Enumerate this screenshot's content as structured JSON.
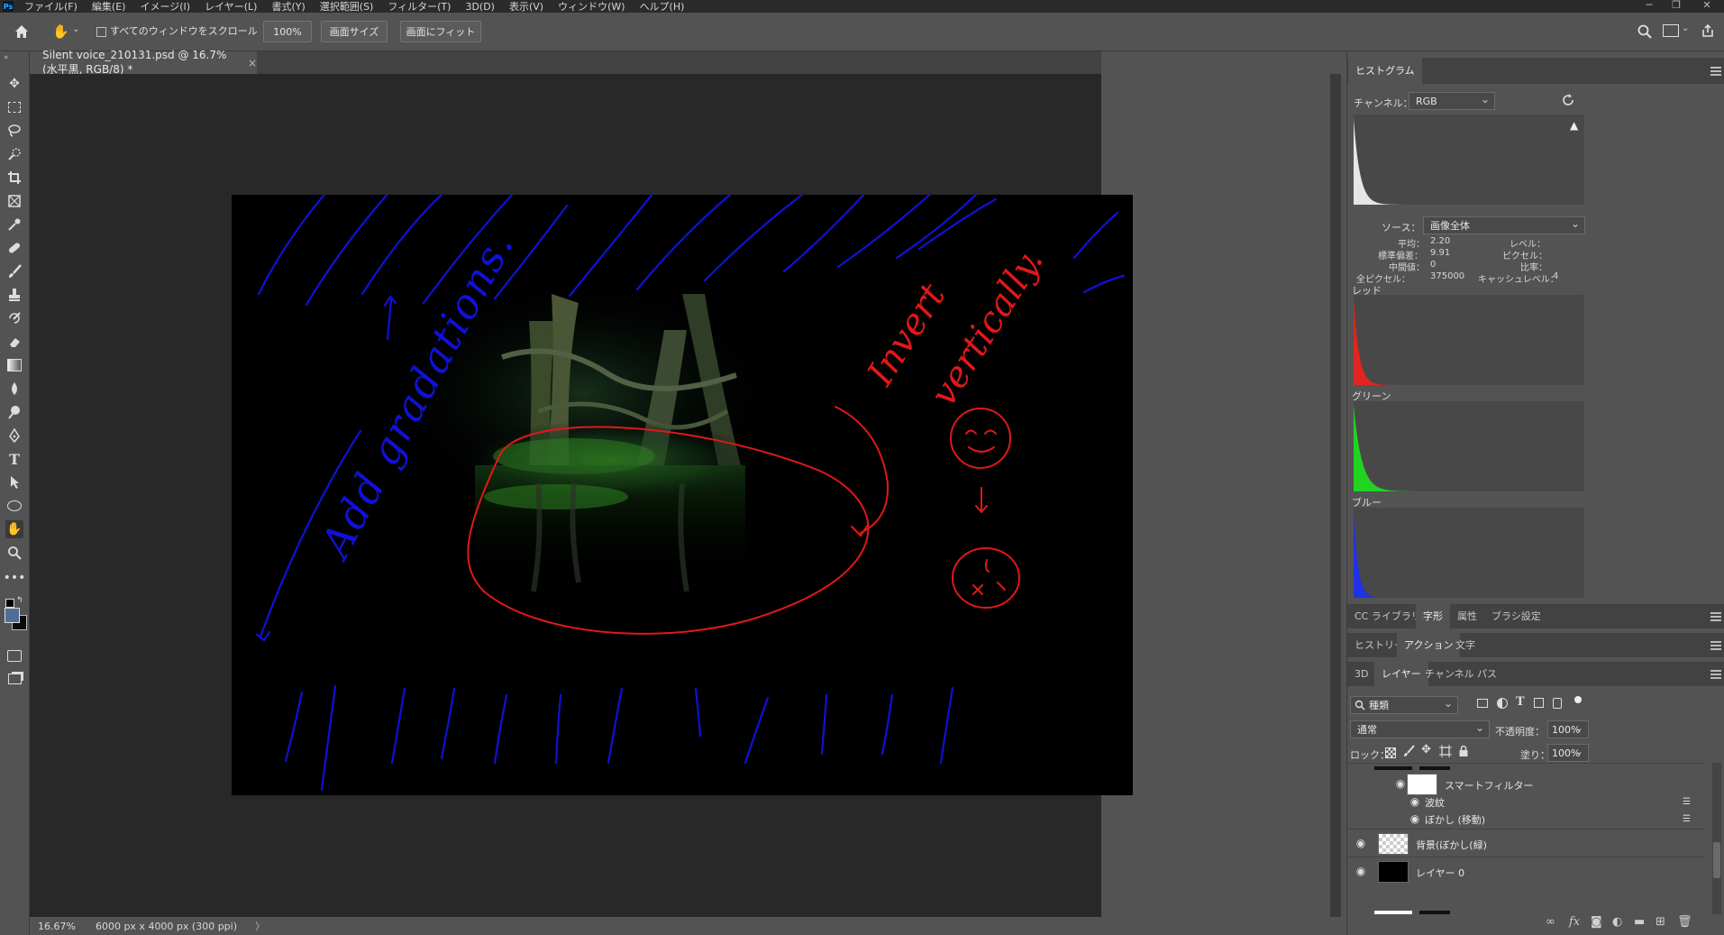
{
  "app": {
    "logo": "Ps",
    "menu": [
      "ファイル(F)",
      "編集(E)",
      "イメージ(I)",
      "レイヤー(L)",
      "書式(Y)",
      "選択範囲(S)",
      "フィルター(T)",
      "3D(D)",
      "表示(V)",
      "ウィンドウ(W)",
      "ヘルプ(H)"
    ],
    "window_controls": [
      "─",
      "❐",
      "✕"
    ]
  },
  "options": {
    "scroll_all_label": "すべてのウィンドウをスクロール",
    "zoom_value": "100%",
    "fit_screen_label": "画面サイズ",
    "fill_screen_label": "画面にフィット"
  },
  "document": {
    "tab_title": "Silent voice_210131.psd @ 16.7% (水平黒, RGB/8) *",
    "tab_close": "×",
    "annotations": {
      "left_text": "Add gradations.",
      "right_text_line1": "Invert",
      "right_text_line2": "vertically."
    }
  },
  "status": {
    "zoom": "16.67%",
    "doc_info": "6000 px x 4000 px (300 ppi)",
    "arrow": "〉"
  },
  "histogram": {
    "tab": "ヒストグラム",
    "channel_label": "チャンネル：",
    "channel_value": "RGB",
    "source_label": "ソース：",
    "source_value": "画像全体",
    "stats_left": [
      {
        "label": "平均：",
        "value": "2.20"
      },
      {
        "label": "標準偏差：",
        "value": "9.91"
      },
      {
        "label": "中間値：",
        "value": "0"
      },
      {
        "label": "全ピクセル：",
        "value": "375000"
      }
    ],
    "stats_right": [
      {
        "label": "レベル：",
        "value": ""
      },
      {
        "label": "ピクセル：",
        "value": ""
      },
      {
        "label": "比率：",
        "value": ""
      },
      {
        "label": "キャッシュレベル：",
        "value": "4"
      }
    ],
    "channels": [
      {
        "name": "レッド",
        "color": "#e0261f"
      },
      {
        "name": "グリーン",
        "color": "#22d322"
      },
      {
        "name": "ブルー",
        "color": "#2230e8"
      }
    ],
    "composite_color": "#e6e6e6"
  },
  "panel_tabs": {
    "row1": [
      "CC ライブラリ",
      "字形",
      "属性",
      "ブラシ設定"
    ],
    "row2": [
      "ヒストリー",
      "アクション",
      "文字"
    ],
    "row3": [
      "3D",
      "レイヤー",
      "チャンネル",
      "パス"
    ]
  },
  "layers": {
    "filter_kind": "種類",
    "blend_mode": "通常",
    "opacity_label": "不透明度：",
    "opacity_value": "100%",
    "lock_label": "ロック：",
    "fill_label": "塗り：",
    "fill_value": "100%",
    "smart_filter_label": "スマートフィルター",
    "filters": [
      "波紋",
      "ぼかし (移動)"
    ],
    "items": [
      {
        "name": "背景(ぼかし(緑)"
      },
      {
        "name": "レイヤー 0"
      }
    ]
  }
}
